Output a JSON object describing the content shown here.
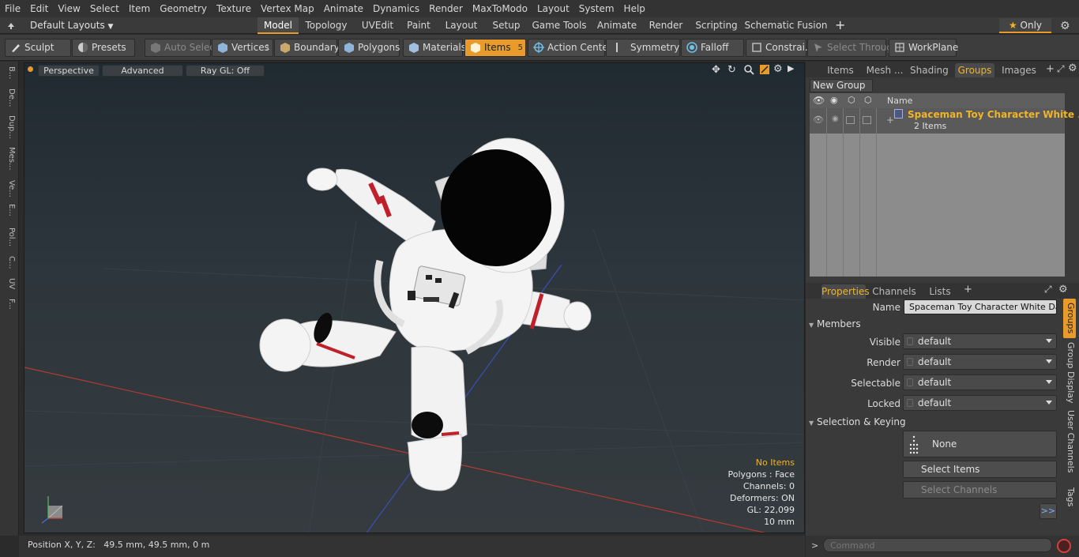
{
  "menubar": [
    "File",
    "Edit",
    "View",
    "Select",
    "Item",
    "Geometry",
    "Texture",
    "Vertex Map",
    "Animate",
    "Dynamics",
    "Render",
    "MaxToModo",
    "Layout",
    "System",
    "Help"
  ],
  "layoutbar": {
    "layouts_label": "Default Layouts",
    "tabs": [
      "Model",
      "Topology",
      "UVEdit",
      "Paint",
      "Layout",
      "Setup",
      "Game Tools",
      "Animate",
      "Render",
      "Scripting",
      "Schematic Fusion"
    ],
    "add": "+",
    "only_label": "Only"
  },
  "toolbar": {
    "sculpt": "Sculpt",
    "presets": "Presets",
    "auto_select": "Auto Select",
    "vertices": "Vertices",
    "vertices_count": "1",
    "boundary": "Boundary",
    "polygons": "Polygons",
    "materials": "Materials",
    "items": "Items",
    "items_count": "5",
    "action_center": "Action Center",
    "symmetry": "Symmetry",
    "falloff": "Falloff",
    "constraints": "Constrai...",
    "select_through": "Select Through",
    "workplane": "WorkPlane"
  },
  "leftstrip": [
    "B...",
    "De...",
    "Dup...",
    "Mes...",
    "Ve...",
    "E...",
    "Pol...",
    "C...",
    "UV",
    "F..."
  ],
  "viewport": {
    "perspective": "Perspective",
    "advanced": "Advanced",
    "raygl": "Ray GL: Off",
    "stats": {
      "no_items": "No Items",
      "polygons": "Polygons : Face",
      "channels": "Channels: 0",
      "deformers": "Deformers: ON",
      "gl": "GL: 22,099",
      "scale": "10 mm"
    }
  },
  "statusbar": {
    "position": "Position X, Y, Z:   49.5 mm, 49.5 mm, 0 m"
  },
  "groups_panel": {
    "tabs": [
      "Items",
      "Mesh ...",
      "Shading",
      "Groups",
      "Images"
    ],
    "new_group": "New Group",
    "col_name": "Name",
    "group_name": "Spaceman Toy Character White ...",
    "group_items": "2 Items"
  },
  "properties_panel": {
    "tabs": [
      "Properties",
      "Channels",
      "Lists"
    ],
    "name_label": "Name",
    "name_value": "Spaceman Toy Character White Danci",
    "members_header": "Members",
    "fields": [
      {
        "label": "Visible",
        "value": "default"
      },
      {
        "label": "Render",
        "value": "default"
      },
      {
        "label": "Selectable",
        "value": "default"
      },
      {
        "label": "Locked",
        "value": "default"
      }
    ],
    "sel_keying_header": "Selection & Keying",
    "none_label": "None",
    "select_items": "Select Items",
    "select_channels": "Select Channels",
    "more": ">>",
    "side_tabs": [
      "Groups",
      "Group Display",
      "User Channels",
      "Tags"
    ]
  },
  "command": {
    "prompt": ">",
    "placeholder": "Command"
  }
}
